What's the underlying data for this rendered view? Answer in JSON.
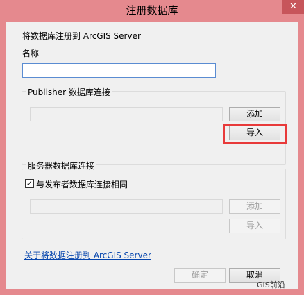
{
  "window": {
    "title": "注册数据库",
    "close_glyph": "✕"
  },
  "form": {
    "intro": "将数据库注册到 ArcGIS Server",
    "name_label": "名称",
    "name_value": ""
  },
  "publisher_group": {
    "label": "Publisher 数据库连接",
    "connection_value": "",
    "add_label": "添加",
    "import_label": "导入"
  },
  "server_group": {
    "label": "服务器数据库连接",
    "same_as_publisher_label": "与发布者数据库连接相同",
    "same_as_publisher_checked": true,
    "check_glyph": "✓",
    "connection_value": "",
    "add_label": "添加",
    "import_label": "导入"
  },
  "footer": {
    "help_link": "关于将数据注册到 ArcGIS Server",
    "ok_label": "确定",
    "cancel_label": "取消"
  },
  "watermark": {
    "text": "GIS前沿"
  },
  "colors": {
    "frame": "#e5898e",
    "highlight": "#e83a3a",
    "link": "#0645ad"
  }
}
